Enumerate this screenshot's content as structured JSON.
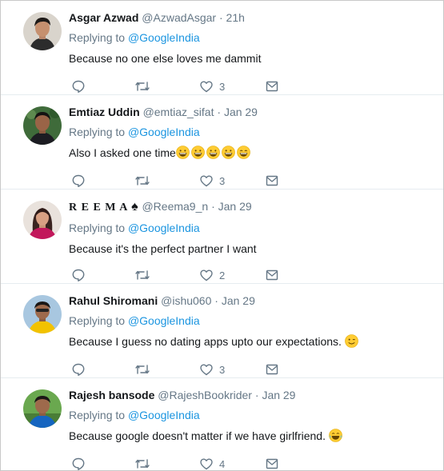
{
  "reply_prefix": "Replying to",
  "reply_handle": "@GoogleIndia",
  "tweets": [
    {
      "name": "Asgar Azwad",
      "handle": "@AzwadAsgar",
      "time": "21h",
      "text": "Because no one else loves me dammit",
      "likes": "3"
    },
    {
      "name": "Emtiaz Uddin",
      "handle": "@emtiaz_sifat",
      "time": "Jan 29",
      "text": "Also I asked one time",
      "likes": "3"
    },
    {
      "name": "R E E M A",
      "handle": "@Reema9_n",
      "time": "Jan 29",
      "text": "Because it's the perfect partner I want",
      "likes": "2"
    },
    {
      "name": "Rahul Shiromani",
      "handle": "@ishu060",
      "time": "Jan 29",
      "text": "Because I guess no dating apps upto our expectations.",
      "likes": "3"
    },
    {
      "name": "Rajesh bansode",
      "handle": "@RajeshBookrider",
      "time": "Jan 29",
      "text": "Because google doesn't matter if we have girlfriend.",
      "likes": "4"
    }
  ],
  "colors": {
    "link": "#1b95e0",
    "muted": "#657786",
    "text": "#14171a"
  },
  "icons": [
    "reply-icon",
    "retweet-icon",
    "like-icon",
    "direct-message-icon",
    "spade-icon"
  ]
}
